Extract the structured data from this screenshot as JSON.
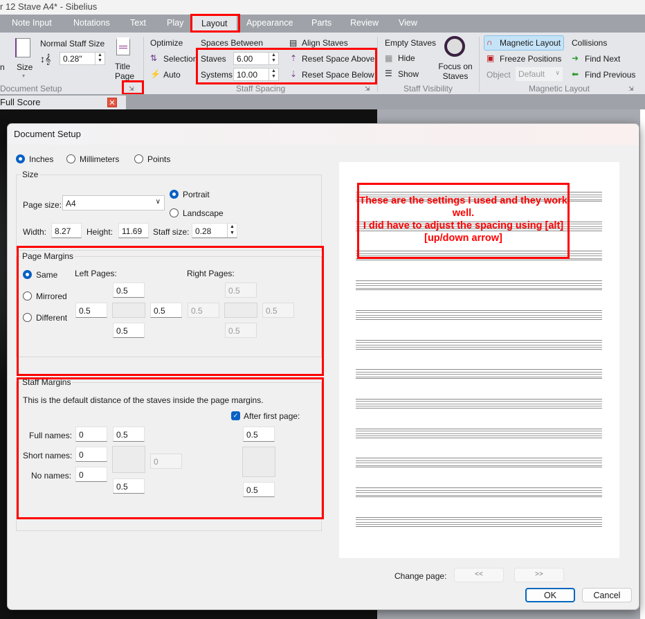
{
  "window": {
    "title": "r 12 Stave A4* - Sibelius"
  },
  "tabs": [
    "Note Input",
    "Notations",
    "Text",
    "Play",
    "Layout",
    "Appearance",
    "Parts",
    "Review",
    "View"
  ],
  "active_tab": "Layout",
  "ribbon": {
    "document_setup": {
      "partial_label": "n",
      "size_label": "Size",
      "normal_staff_size_label": "Normal Staff Size",
      "staff_size_value": "0.28\"",
      "title_page_label": "Title Page",
      "group_label": "Document Setup"
    },
    "staff_spacing": {
      "optimize_label": "Optimize",
      "selection_label": "Selection",
      "auto_label": "Auto",
      "spaces_between_label": "Spaces Between",
      "staves_label": "Staves",
      "staves_value": "6.00",
      "systems_label": "Systems",
      "systems_value": "10.00",
      "align_staves": "Align Staves",
      "reset_above": "Reset Space Above",
      "reset_below": "Reset Space Below",
      "group_label": "Staff Spacing"
    },
    "staff_visibility": {
      "empty_staves_label": "Empty Staves",
      "hide_label": "Hide",
      "show_label": "Show",
      "focus_label": "Focus on Staves",
      "group_label": "Staff Visibility"
    },
    "magnetic_layout": {
      "magnetic_label": "Magnetic Layout",
      "freeze_label": "Freeze Positions",
      "object_label": "Object",
      "object_value": "Default",
      "collisions_label": "Collisions",
      "find_next": "Find Next",
      "find_previous": "Find Previous",
      "group_label": "Magnetic Layout"
    }
  },
  "score_tab": {
    "label": "Full Score"
  },
  "dialog": {
    "title": "Document Setup",
    "units": [
      {
        "label": "Inches",
        "selected": true
      },
      {
        "label": "Millimeters",
        "selected": false
      },
      {
        "label": "Points",
        "selected": false
      }
    ],
    "size": {
      "group_label": "Size",
      "page_size_label": "Page size:",
      "page_size_value": "A4",
      "portrait_label": "Portrait",
      "landscape_label": "Landscape",
      "orientation": "Portrait",
      "width_label": "Width:",
      "width_value": "8.27",
      "height_label": "Height:",
      "height_value": "11.69",
      "staff_size_label": "Staff size:",
      "staff_size_value": "0.28"
    },
    "page_margins": {
      "group_label": "Page Margins",
      "same_label": "Same",
      "mirrored_label": "Mirrored",
      "different_label": "Different",
      "mode": "Same",
      "left_pages_label": "Left Pages:",
      "right_pages_label": "Right Pages:",
      "left": {
        "top": "0.5",
        "left": "0.5",
        "right": "0.5",
        "bottom": "0.5"
      },
      "right": {
        "top": "0.5",
        "left": "0.5",
        "right": "0.5",
        "bottom": "0.5"
      }
    },
    "staff_margins": {
      "group_label": "Staff Margins",
      "description": "This is the default distance of the staves inside the page margins.",
      "after_first_page_label": "After first page:",
      "after_first_page_checked": true,
      "full_names_label": "Full names:",
      "full_names_value": "0",
      "short_names_label": "Short names:",
      "short_names_value": "0",
      "no_names_label": "No names:",
      "no_names_value": "0",
      "top": "0.5",
      "bottom": "0.5",
      "right_disabled": "0",
      "after_top": "0.5",
      "after_bottom": "0.5"
    },
    "change_page_label": "Change page:",
    "prev_label": "<<",
    "next_label": ">>",
    "ok_label": "OK",
    "cancel_label": "Cancel",
    "preview_staff_count": 12
  },
  "annotation": {
    "text_line1": "These are the settings I used and they work well.",
    "text_line2": "I did have to adjust the spacing using [alt][up/down arrow]",
    "color": "#ff0000"
  },
  "colors": {
    "accent": "#0861c4",
    "highlight": "#ff0000",
    "ribbon": "#e4e6e9",
    "tabbar": "#9fa3a9"
  }
}
